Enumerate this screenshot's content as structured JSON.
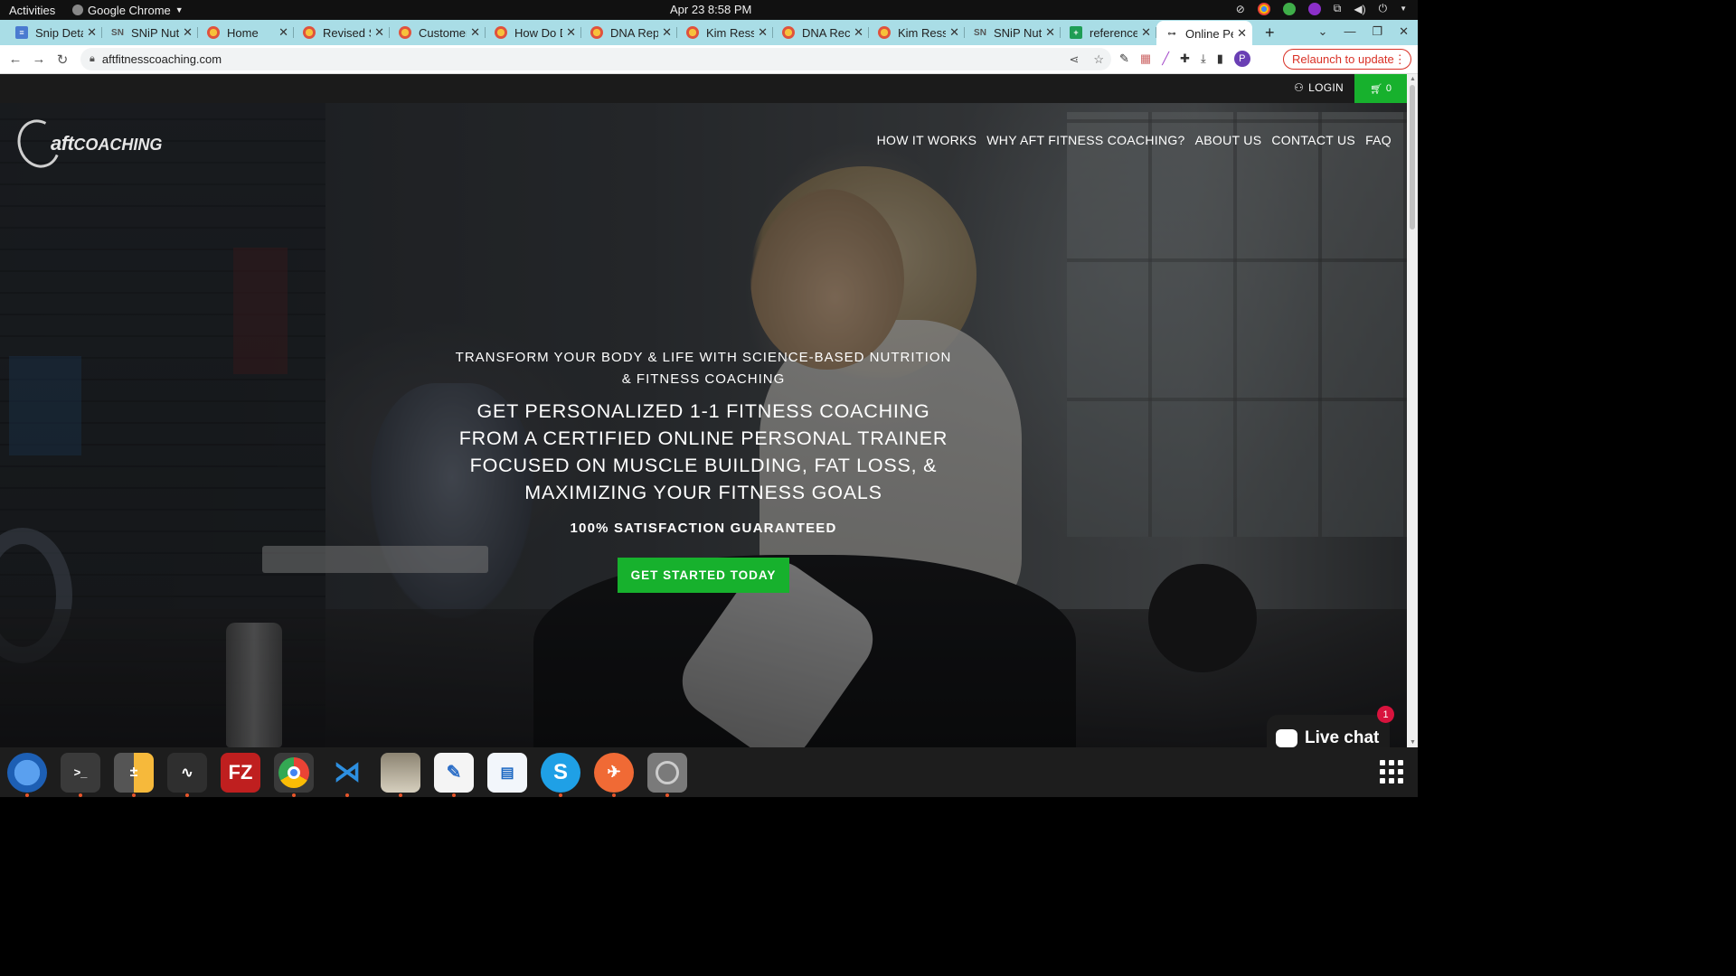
{
  "os": {
    "activities": "Activities",
    "app_name": "Google Chrome",
    "clock": "Apr 23  8:58 PM"
  },
  "browser": {
    "tabs": [
      {
        "title": "Snip Deta",
        "icon": "doc-icon"
      },
      {
        "title": "SNiP Nutr",
        "icon": "snip-icon"
      },
      {
        "title": "Home",
        "icon": "chrome-favicon"
      },
      {
        "title": "Revised S",
        "icon": "chrome-favicon"
      },
      {
        "title": "Customer",
        "icon": "chrome-favicon"
      },
      {
        "title": "How Do D",
        "icon": "chrome-favicon"
      },
      {
        "title": "DNA Rep",
        "icon": "chrome-favicon"
      },
      {
        "title": "Kim Ressl",
        "icon": "chrome-favicon"
      },
      {
        "title": "DNA Rec",
        "icon": "chrome-favicon"
      },
      {
        "title": "Kim Ressl",
        "icon": "chrome-favicon"
      },
      {
        "title": "SNiP Nutr",
        "icon": "snip-icon"
      },
      {
        "title": "reference",
        "icon": "sheet-icon"
      },
      {
        "title": "Online Pe",
        "icon": "dumbbell-icon",
        "active": true
      }
    ],
    "new_tab": "+",
    "url": "aftfitnesscoaching.com",
    "relaunch": "Relaunch to update",
    "profile_initial": "P"
  },
  "site": {
    "login": "LOGIN",
    "cart_count": "0",
    "logo_prefix": "aft",
    "logo_word": "COACHING",
    "nav": [
      "HOW IT WORKS",
      "WHY AFT FITNESS COACHING?",
      "ABOUT US",
      "CONTACT US",
      "FAQ"
    ],
    "tagline_1": "TRANSFORM YOUR BODY & LIFE WITH SCIENCE-BASED NUTRITION",
    "tagline_2": "& FITNESS COACHING",
    "headline_1": "GET PERSONALIZED 1-1 FITNESS COACHING",
    "headline_2": "FROM A CERTIFIED ONLINE PERSONAL TRAINER",
    "headline_3": "FOCUSED ON MUSCLE BUILDING, FAT LOSS, &",
    "headline_4": "MAXIMIZING YOUR FITNESS GOALS",
    "guarantee": "100% SATISFACTION GUARANTEED",
    "cta": "GET STARTED TODAY",
    "live_chat": "Live chat",
    "chat_badge": "1"
  },
  "dock": {
    "apps": [
      "thunderbird-icon",
      "terminal-icon",
      "calculator-icon",
      "system-monitor-icon",
      "filezilla-icon",
      "chrome-icon",
      "vscode-icon",
      "files-icon",
      "text-editor-icon",
      "writer-icon",
      "skype-icon",
      "postman-icon",
      "disc-icon"
    ]
  },
  "colors": {
    "accent_green": "#17b12d",
    "tab_strip": "#a9dde6",
    "relaunch_red": "#d93025"
  }
}
